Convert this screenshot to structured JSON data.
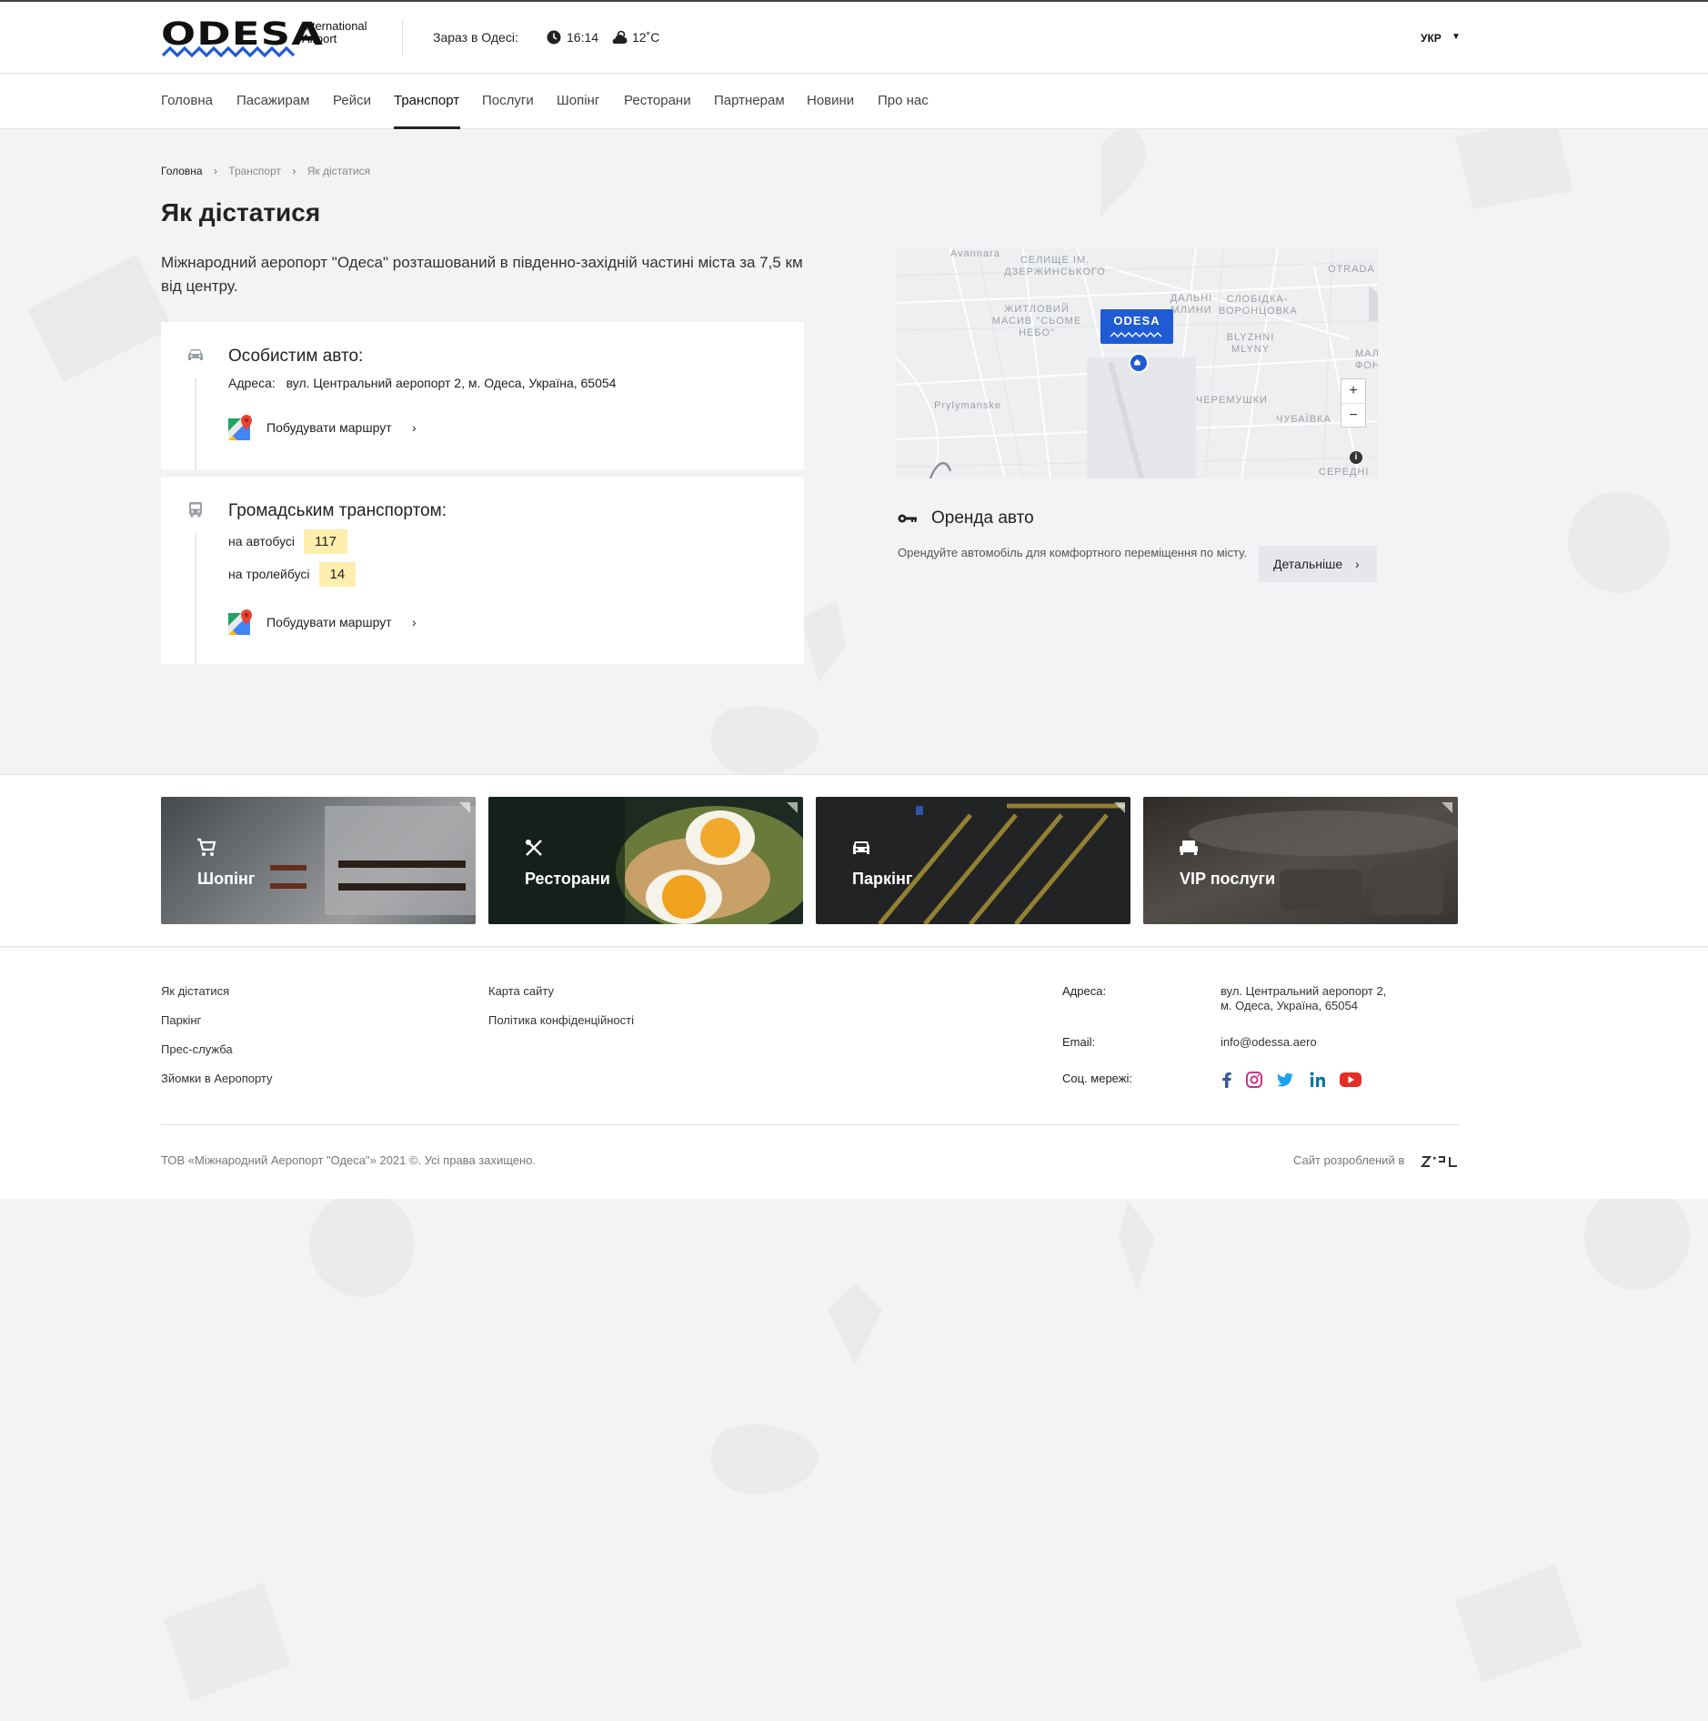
{
  "header": {
    "logo_word": "ODESA",
    "logo_sub": "International Airport",
    "now_label": "Зараз в Одесі:",
    "time": "16:14",
    "temperature": "12˚C",
    "language": "УКР"
  },
  "nav": {
    "items": [
      "Головна",
      "Пасажирам",
      "Рейси",
      "Транспорт",
      "Послуги",
      "Шопінг",
      "Ресторани",
      "Партнерам",
      "Новини",
      "Про нас"
    ],
    "active": "Транспорт"
  },
  "breadcrumb": [
    "Головна",
    "Транспорт",
    "Як дістатися"
  ],
  "page": {
    "title": "Як дістатися",
    "intro": "Міжнародний аеропорт \"Одеса\" розташований в південно-західній частині міста за 7,5 км від центру."
  },
  "car_card": {
    "title": "Особистим авто:",
    "address_label": "Адреса:",
    "address": "вул. Центральний аеропорт 2, м. Одеса, Україна, 65054",
    "route_label": "Побудувати маршрут"
  },
  "transit_card": {
    "title": "Громадським транспортом:",
    "bus_label": "на автобусі",
    "bus_number": "117",
    "trolley_label": "на тролейбусі",
    "trolley_number": "14",
    "route_label": "Побудувати маршрут"
  },
  "map": {
    "pin_label": "ODESA",
    "labels": [
      "Avannara",
      "СЕЛИЩЕ ІМ. ДЗЕРЖИНСЬКОГО",
      "OTRADA",
      "ЖИТЛОВИЙ МАСИВ \"СЬОМЕ НЕБО\"",
      "ДАЛЬНІ МЛИНИ",
      "СЛОБІДКА-ВОРОНЦОВКА",
      "BLYZHNI MLYNY",
      "Prylymanske",
      "ЧЕРЕМУШКИ",
      "ЧУБАЇВКА",
      "МАЛ ФОН",
      "СЕРЕДНІ"
    ],
    "zoom_in": "+",
    "zoom_out": "−",
    "info": "i"
  },
  "rental": {
    "title": "Оренда авто",
    "description": "Орендуйте автомобіль для комфортного переміщення по місту.",
    "button_label": "Детальніше"
  },
  "services": [
    {
      "label": "Шопінг",
      "icon": "cart-icon"
    },
    {
      "label": "Ресторани",
      "icon": "cutlery-icon"
    },
    {
      "label": "Паркінг",
      "icon": "car-icon"
    },
    {
      "label": "VIP послуги",
      "icon": "sofa-icon"
    }
  ],
  "footer": {
    "col1": [
      "Як дістатися",
      "Паркінг",
      "Прес-служба",
      "Зйомки в Аеропорту"
    ],
    "col2": [
      "Карта сайту",
      "Політика конфіденційності"
    ],
    "address_label": "Адреса:",
    "address_line1": "вул. Центральний аеропорт 2,",
    "address_line2": "м. Одеса, Україна, 65054",
    "email_label": "Email:",
    "email": "info@odessa.aero",
    "social_label": "Соц. мережі:",
    "social": [
      "facebook-icon",
      "instagram-icon",
      "twitter-icon",
      "linkedin-icon",
      "youtube-icon"
    ],
    "copyright": "ТОВ «Міжнародний Аеропорт \"Одеса\"» 2021 ©. Усі права захищено.",
    "dev_by": "Сайт розроблений в"
  },
  "colors": {
    "brand_blue": "#1f5bd4",
    "badge_yellow": "#ffeeae",
    "page_bg": "#f2f3f5"
  }
}
